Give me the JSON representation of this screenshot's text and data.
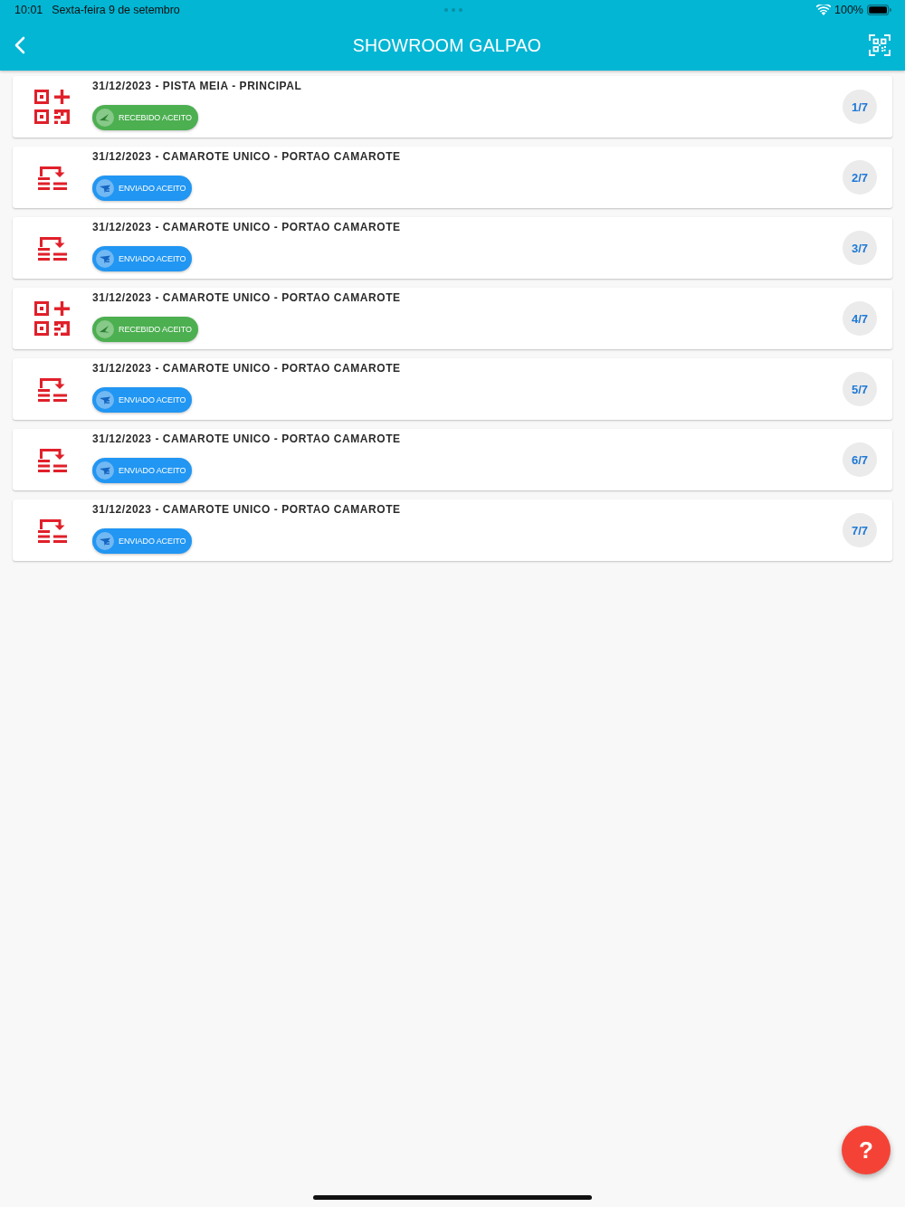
{
  "status_bar": {
    "time": "10:01",
    "date": "Sexta-feira 9 de setembro",
    "battery": "100%"
  },
  "header": {
    "title": "SHOWROOM GALPAO"
  },
  "items": [
    {
      "kind": "qr",
      "title": "31/12/2023 - PISTA MEIA - PRINCIPAL",
      "status": {
        "kind": "received",
        "label": "RECEBIDO ACEITO"
      },
      "counter": "1/7"
    },
    {
      "kind": "transfer",
      "title": "31/12/2023 - CAMAROTE UNICO - PORTAO CAMAROTE",
      "status": {
        "kind": "sent",
        "label": "ENVIADO ACEITO"
      },
      "counter": "2/7"
    },
    {
      "kind": "transfer",
      "title": "31/12/2023 - CAMAROTE UNICO - PORTAO CAMAROTE",
      "status": {
        "kind": "sent",
        "label": "ENVIADO ACEITO"
      },
      "counter": "3/7"
    },
    {
      "kind": "qr",
      "title": "31/12/2023 - CAMAROTE UNICO - PORTAO CAMAROTE",
      "status": {
        "kind": "received",
        "label": "RECEBIDO ACEITO"
      },
      "counter": "4/7"
    },
    {
      "kind": "transfer",
      "title": "31/12/2023 - CAMAROTE UNICO - PORTAO CAMAROTE",
      "status": {
        "kind": "sent",
        "label": "ENVIADO ACEITO"
      },
      "counter": "5/7"
    },
    {
      "kind": "transfer",
      "title": "31/12/2023 - CAMAROTE UNICO - PORTAO CAMAROTE",
      "status": {
        "kind": "sent",
        "label": "ENVIADO ACEITO"
      },
      "counter": "6/7"
    },
    {
      "kind": "transfer",
      "title": "31/12/2023 - CAMAROTE UNICO - PORTAO CAMAROTE",
      "status": {
        "kind": "sent",
        "label": "ENVIADO ACEITO"
      },
      "counter": "7/7"
    }
  ],
  "help_button": {
    "label": "?"
  }
}
